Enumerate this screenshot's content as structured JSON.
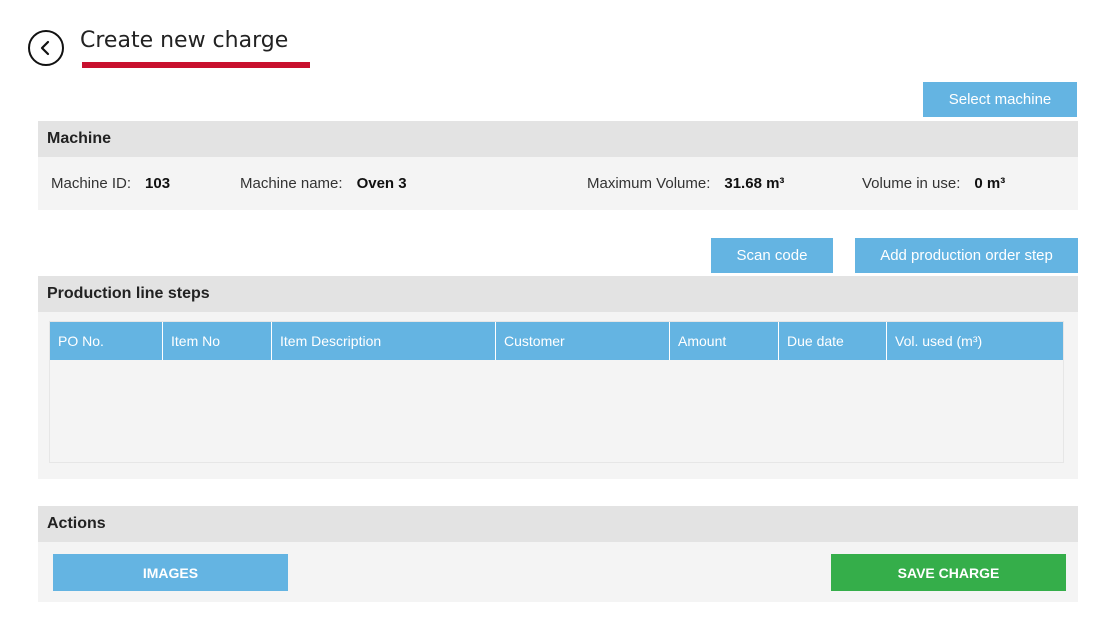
{
  "header": {
    "title": "Create new charge"
  },
  "machine_section": {
    "select_machine_label": "Select machine",
    "title": "Machine",
    "machine_id_label": "Machine ID:",
    "machine_id_value": "103",
    "machine_name_label": "Machine name:",
    "machine_name_value": "Oven 3",
    "max_volume_label": "Maximum Volume:",
    "max_volume_value": "31.68 m³",
    "volume_in_use_label": "Volume in use:",
    "volume_in_use_value": "0 m³"
  },
  "steps_section": {
    "scan_code_label": "Scan code",
    "add_po_step_label": "Add production order step",
    "title": "Production line steps",
    "columns": [
      "PO No.",
      "Item No",
      "Item Description",
      "Customer",
      "Amount",
      "Due date",
      "Vol. used (m³)"
    ],
    "rows": []
  },
  "actions_section": {
    "title": "Actions",
    "images_label": "IMAGES",
    "save_charge_label": "SAVE CHARGE"
  },
  "colors": {
    "accent_blue": "#64b4e2",
    "save_green": "#35ae4a",
    "title_underline_red": "#c8102e"
  },
  "icons": {
    "back": "chevron-left-circle-icon"
  }
}
